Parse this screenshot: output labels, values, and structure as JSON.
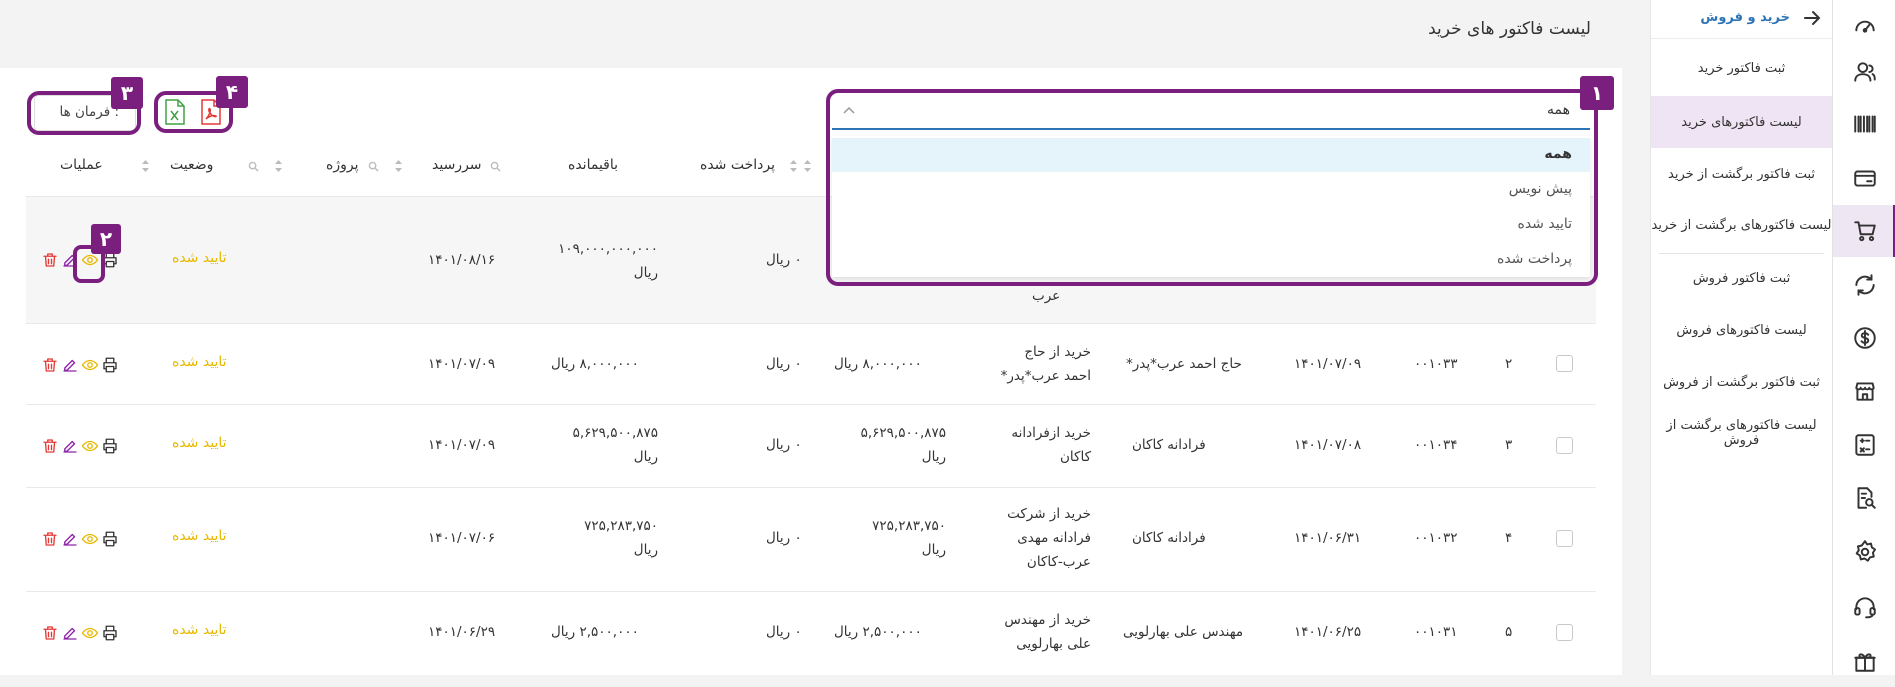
{
  "rail": {
    "items": [
      {
        "icon": "dashboard-icon"
      },
      {
        "icon": "users-icon"
      },
      {
        "icon": "barcode-icon"
      },
      {
        "icon": "card-icon"
      },
      {
        "icon": "cart-icon",
        "active": true
      },
      {
        "icon": "sync-icon"
      },
      {
        "icon": "dollar-icon"
      },
      {
        "icon": "store-icon"
      },
      {
        "icon": "calculator-icon"
      },
      {
        "icon": "report-search-icon"
      },
      {
        "icon": "settings-icon"
      },
      {
        "icon": "support-icon"
      },
      {
        "icon": "gift-icon"
      }
    ]
  },
  "submenu": {
    "title": "خرید و فروش",
    "items": [
      {
        "label": "ثبت فاکتور خرید"
      },
      {
        "label": "لیست فاکتورهای خرید",
        "active": true
      },
      {
        "label": "ثبت فاکتور برگشت از خرید"
      },
      {
        "label": "لیست فاکتورهای برگشت از خرید"
      },
      {
        "label": "ثبت فاکتور فروش"
      },
      {
        "label": "لیست فاکتورهای فروش"
      },
      {
        "label": "ثبت فاکتور برگشت از فروش"
      },
      {
        "label": "لیست فاکتورهای برگشت از فروش"
      }
    ]
  },
  "page": {
    "title": "لیست فاکتور های خرید"
  },
  "toolbar": {
    "commands_label": ": فرمان ها",
    "export_excel": "excel-export-icon",
    "export_pdf": "pdf-export-icon"
  },
  "filter": {
    "selected": "همه",
    "options": [
      "همه",
      "پیش نویس",
      "تایید شده",
      "پرداخت شده"
    ]
  },
  "columns": [
    "عملیات",
    "وضعیت",
    "پروژه",
    "سررسید",
    "باقیمانده",
    "پرداخت شده"
  ],
  "rows": [
    {
      "remaining_l1": "۱۰۹,۰۰۰,۰۰۰,۰۰۰",
      "remaining_l2": "ریال",
      "paid": "۰ ریال",
      "due": "۱۴۰۱/۰۸/۱۶",
      "status": "تایید شده",
      "desc_tail": "عرب"
    },
    {
      "num": "۲",
      "code": "۰۰۱۰۳۳",
      "date": "۱۴۰۱/۰۷/۰۹",
      "supplier": "حاج احمد عرب*پدر*",
      "desc_l1": "خرید از حاج",
      "desc_l2": "احمد عرب*پدر*",
      "amount_l1": "۸,۰۰۰,۰۰۰ ریال",
      "amount_l2": "",
      "paid": "۰ ریال",
      "remaining_l1": "۸,۰۰۰,۰۰۰ ریال",
      "remaining_l2": "",
      "due": "۱۴۰۱/۰۷/۰۹",
      "status": "تایید شده"
    },
    {
      "num": "۳",
      "code": "۰۰۱۰۳۴",
      "date": "۱۴۰۱/۰۷/۰۸",
      "supplier": "فرادانه کاکان",
      "desc_l1": "خرید ازفرادانه",
      "desc_l2": "کاکان",
      "amount_l1": "۵,۶۲۹,۵۰۰,۸۷۵",
      "amount_l2": "ریال",
      "paid": "۰ ریال",
      "remaining_l1": "۵,۶۲۹,۵۰۰,۸۷۵",
      "remaining_l2": "ریال",
      "due": "۱۴۰۱/۰۷/۰۹",
      "status": "تایید شده"
    },
    {
      "num": "۴",
      "code": "۰۰۱۰۳۲",
      "date": "۱۴۰۱/۰۶/۳۱",
      "supplier": "فرادانه کاکان",
      "desc_l1": "خرید از شرکت",
      "desc_l2": "فرادانه مهدی",
      "desc_l3": "عرب-کاکان",
      "amount_l1": "۷۲۵,۲۸۳,۷۵۰",
      "amount_l2": "ریال",
      "paid": "۰ ریال",
      "remaining_l1": "۷۲۵,۲۸۳,۷۵۰",
      "remaining_l2": "ریال",
      "due": "۱۴۰۱/۰۷/۰۶",
      "status": "تایید شده"
    },
    {
      "num": "۵",
      "code": "۰۰۱۰۳۱",
      "date": "۱۴۰۱/۰۶/۲۵",
      "supplier": "مهندس علی بهارلویی",
      "desc_l1": "خرید از مهندس",
      "desc_l2": "علی بهارلویی",
      "amount_l1": "۲,۵۰۰,۰۰۰ ریال",
      "amount_l2": "",
      "paid": "۰ ریال",
      "remaining_l1": "۲,۵۰۰,۰۰۰ ریال",
      "remaining_l2": "",
      "due": "۱۴۰۱/۰۶/۲۹",
      "status": "تایید شده"
    }
  ],
  "callouts": [
    "۱",
    "۲",
    "۳",
    "۴"
  ],
  "colors": {
    "accent": "#7b1f7e",
    "status": "#e8b800",
    "delete": "#e53935",
    "edit": "#8e24aa",
    "view": "#e8b800"
  }
}
